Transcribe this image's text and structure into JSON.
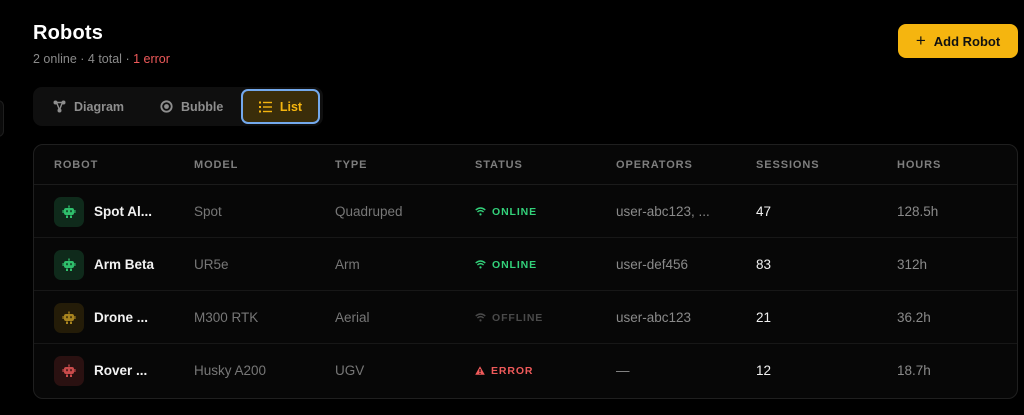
{
  "header": {
    "title": "Robots",
    "summary": {
      "online": "2 online",
      "sep1": " · ",
      "total": "4 total",
      "sep2": " · ",
      "errors": "1 error"
    },
    "add_button_label": "Add Robot"
  },
  "view_switch": {
    "diagram_label": "Diagram",
    "bubble_label": "Bubble",
    "list_label": "List",
    "active": "List"
  },
  "table": {
    "columns": [
      "ROBOT",
      "MODEL",
      "TYPE",
      "STATUS",
      "OPERATORS",
      "SESSIONS",
      "HOURS"
    ],
    "rows": [
      {
        "name": "Spot Al...",
        "model": "Spot",
        "type": "Quadruped",
        "status": "ONLINE",
        "status_kind": "online",
        "operators": "user-abc123, ...",
        "sessions": "47",
        "hours": "128.5h",
        "icon_color": "#2fbf6c",
        "icon_bg": "#0f2a1b"
      },
      {
        "name": "Arm Beta",
        "model": "UR5e",
        "type": "Arm",
        "status": "ONLINE",
        "status_kind": "online",
        "operators": "user-def456",
        "sessions": "83",
        "hours": "312h",
        "icon_color": "#2fbf6c",
        "icon_bg": "#0f2a1b"
      },
      {
        "name": "Drone ...",
        "model": "M300 RTK",
        "type": "Aerial",
        "status": "OFFLINE",
        "status_kind": "offline",
        "operators": "user-abc123",
        "sessions": "21",
        "hours": "36.2h",
        "icon_color": "#a8841f",
        "icon_bg": "#241c08"
      },
      {
        "name": "Rover ...",
        "model": "Husky A200",
        "type": "UGV",
        "status": "ERROR",
        "status_kind": "error",
        "operators": "—",
        "sessions": "12",
        "hours": "18.7h",
        "icon_color": "#c94b4b",
        "icon_bg": "#2a1111"
      }
    ]
  },
  "colors": {
    "accent": "#f5b50f",
    "online": "#33d17a",
    "offline": "#4a4a4a",
    "error": "#ef5a5a",
    "focus_ring": "#74a9ec"
  }
}
